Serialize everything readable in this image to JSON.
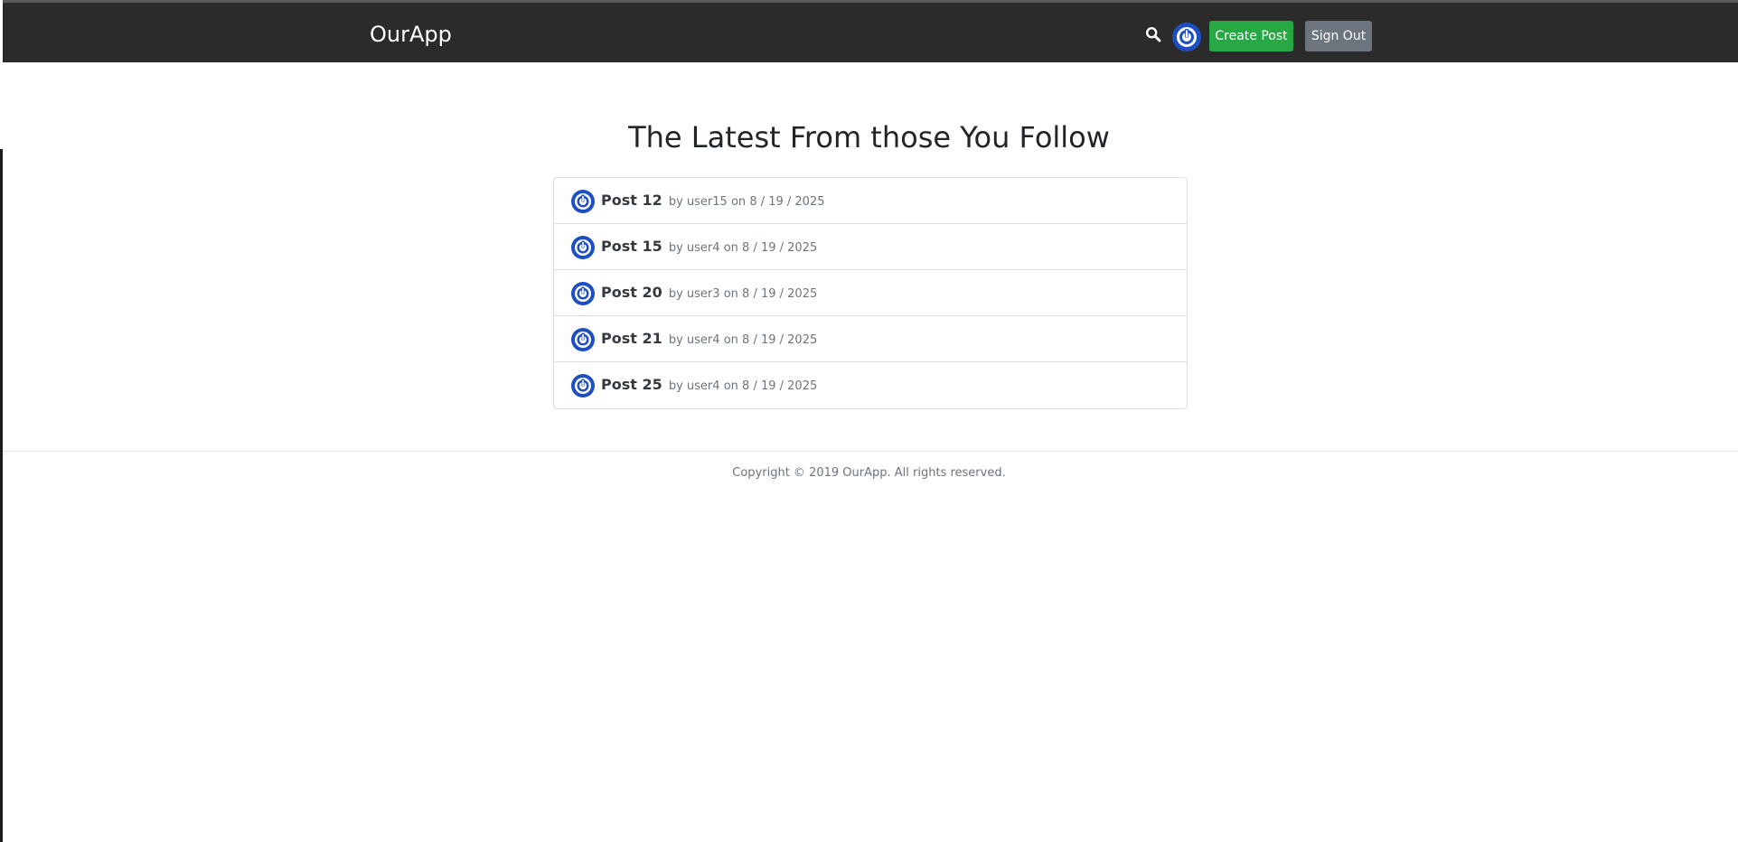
{
  "header": {
    "brand": "OurApp",
    "search_icon": "search-icon",
    "avatar_icon": "power-avatar",
    "create_post_label": "Create Post",
    "sign_out_label": "Sign Out"
  },
  "main": {
    "title": "The Latest From those You Follow",
    "posts": [
      {
        "title": "Post 12",
        "by": "by",
        "author": "user15",
        "on": "on",
        "date": "8 / 19 / 2025"
      },
      {
        "title": "Post 15",
        "by": "by",
        "author": "user4",
        "on": "on",
        "date": "8 / 19 / 2025"
      },
      {
        "title": "Post 20",
        "by": "by",
        "author": "user3",
        "on": "on",
        "date": "8 / 19 / 2025"
      },
      {
        "title": "Post 21",
        "by": "by",
        "author": "user4",
        "on": "on",
        "date": "8 / 19 / 2025"
      },
      {
        "title": "Post 25",
        "by": "by",
        "author": "user4",
        "on": "on",
        "date": "8 / 19 / 2025"
      }
    ]
  },
  "footer": {
    "copyright": "Copyright © 2019 OurApp. All rights reserved."
  },
  "colors": {
    "navbar": "#2b2b2b",
    "create_button": "#28a745",
    "sign_out_button": "#6c757d",
    "avatar_blue": "#1e4fc2"
  }
}
